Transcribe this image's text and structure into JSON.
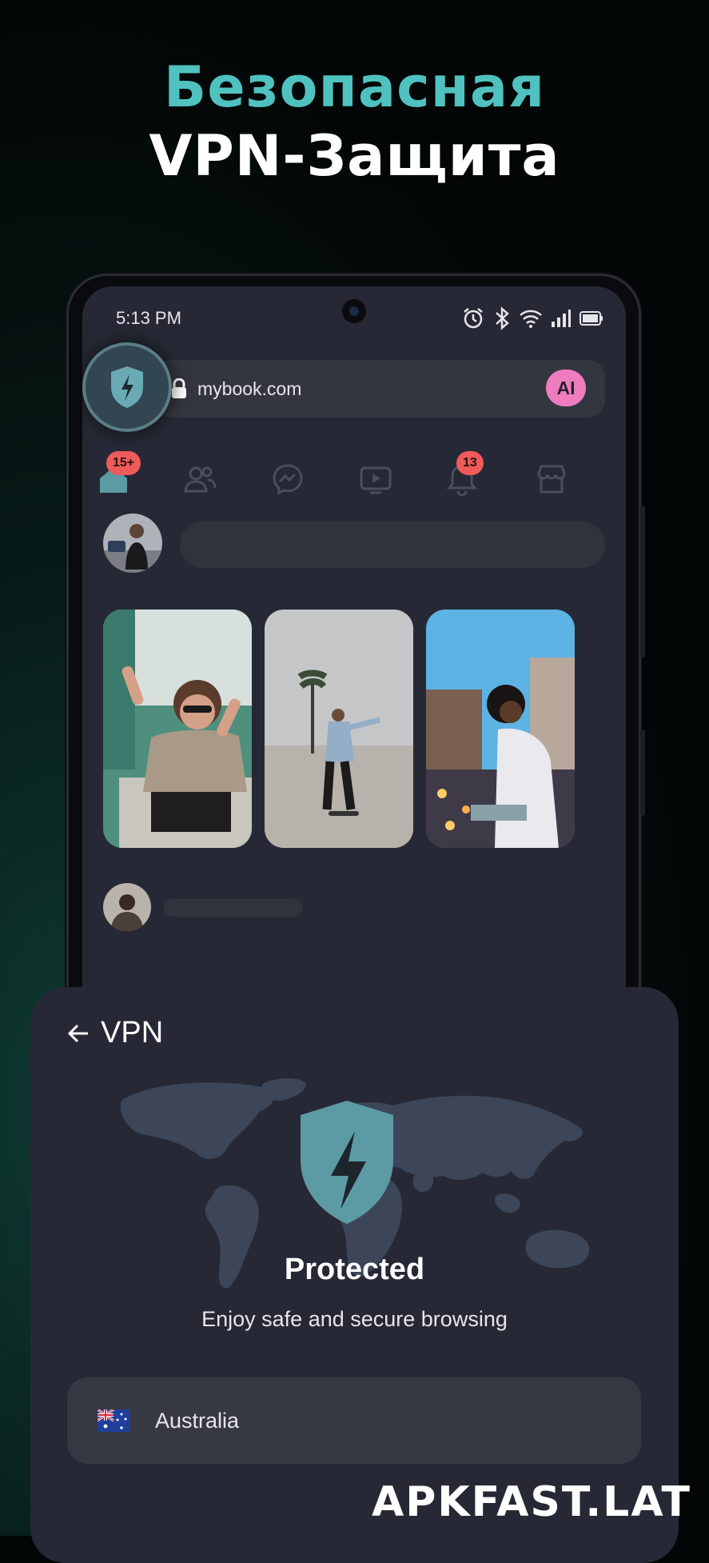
{
  "headline": {
    "line1": "Безопасная",
    "line2": "VPN-Защита"
  },
  "status_bar": {
    "time": "5:13 PM",
    "icons": [
      "alarm-icon",
      "bluetooth-icon",
      "wifi-icon",
      "signal-icon",
      "battery-icon"
    ]
  },
  "browser": {
    "url": "mybook.com",
    "ai_label": "AI"
  },
  "nav_tabs": [
    {
      "name": "home",
      "badge": "15+"
    },
    {
      "name": "friends",
      "badge": ""
    },
    {
      "name": "messenger",
      "badge": ""
    },
    {
      "name": "video",
      "badge": ""
    },
    {
      "name": "notifications",
      "badge": "13"
    },
    {
      "name": "marketplace",
      "badge": ""
    }
  ],
  "vpn_panel": {
    "title": "VPN",
    "status": "Protected",
    "description": "Enjoy safe and secure browsing",
    "country": "Australia"
  },
  "watermark": "APKFAST.LAT",
  "colors": {
    "accent": "#4fc2c0",
    "shield": "#5c9aa4",
    "badge": "#f05a5a",
    "ai": "#f07cc0",
    "panel": "#262935"
  }
}
